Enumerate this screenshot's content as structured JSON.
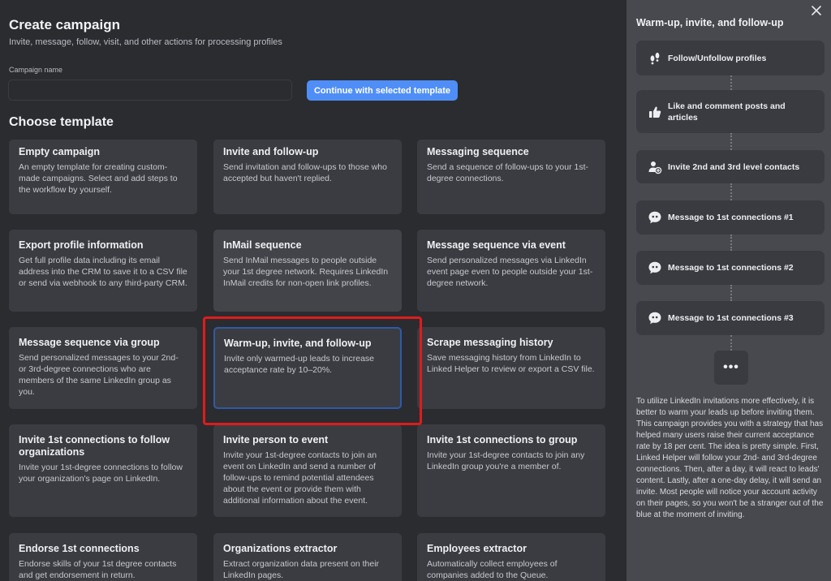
{
  "header": {
    "title": "Create campaign",
    "subtitle": "Invite, message, follow, visit, and other actions for processing profiles"
  },
  "form": {
    "campaign_name_label": "Campaign name",
    "campaign_name_value": "",
    "continue_label": "Continue with selected template"
  },
  "templates": {
    "heading": "Choose template",
    "cards": [
      {
        "title": "Empty campaign",
        "desc": "An empty template for creating custom-made campaigns. Select and add steps to the workflow by yourself."
      },
      {
        "title": "Invite and follow-up",
        "desc": "Send invitation and follow-ups to those who accepted but haven't replied."
      },
      {
        "title": "Messaging sequence",
        "desc": "Send a sequence of follow-ups to your 1st-degree connections."
      },
      {
        "title": "Export profile information",
        "desc": "Get full profile data including its email address into the CRM to save it to a CSV file or send via webhook to any third-party CRM."
      },
      {
        "title": "InMail sequence",
        "desc": "Send InMail messages to people outside your 1st degree network. Requires LinkedIn InMail credits for non-open link profiles."
      },
      {
        "title": "Message sequence via event",
        "desc": "Send personalized messages via LinkedIn event page even to people outside your 1st-degree network."
      },
      {
        "title": "Message sequence via group",
        "desc": "Send personalized messages to your 2nd- or 3rd-degree connections who are members of the same LinkedIn group as you."
      },
      {
        "title": "Warm-up, invite, and follow-up",
        "desc": "Invite only warmed-up leads to increase acceptance rate by 10–20%."
      },
      {
        "title": "Scrape messaging history",
        "desc": "Save messaging history from LinkedIn to Linked Helper to review or export a CSV file."
      },
      {
        "title": "Invite 1st connections to follow organizations",
        "desc": "Invite your 1st-degree connections to follow your organization's page on LinkedIn."
      },
      {
        "title": "Invite person to event",
        "desc": "Invite your 1st-degree contacts to join an event on LinkedIn and send a number of follow-ups to remind potential attendees about the event or provide them with additional information about the event."
      },
      {
        "title": "Invite 1st connections to group",
        "desc": "Invite your 1st-degree contacts to join any LinkedIn group you're a member of."
      },
      {
        "title": "Endorse 1st connections",
        "desc": "Endorse skills of your 1st degree contacts and get endorsement in return."
      },
      {
        "title": "Organizations extractor",
        "desc": "Extract organization data present on their LinkedIn pages."
      },
      {
        "title": "Employees extractor",
        "desc": "Automatically collect employees of companies added to the Queue."
      }
    ]
  },
  "panel": {
    "close_icon": "close-icon",
    "title": "Warm-up, invite, and follow-up",
    "steps": [
      {
        "label": "Follow/Unfollow profiles",
        "icon": "footprints-icon"
      },
      {
        "label": "Like and comment posts and articles",
        "icon": "thumbs-up-icon"
      },
      {
        "label": "Invite 2nd and 3rd level contacts",
        "icon": "add-person-icon"
      },
      {
        "label": "Message to 1st connections #1",
        "icon": "chat-bubble-icon"
      },
      {
        "label": "Message to 1st connections #2",
        "icon": "chat-bubble-icon"
      },
      {
        "label": "Message to 1st connections #3",
        "icon": "chat-bubble-icon"
      }
    ],
    "more_label": "•••",
    "description": "To utilize LinkedIn invitations more effectively, it is better to warm your leads up before inviting them. This campaign provides you with a strategy that has helped many users raise their current acceptance rate by 18 per cent. The idea is pretty simple. First, Linked Helper will follow your 2nd- and 3rd-degree connections. Then, after a day, it will react to leads' content. Lastly, after a one-day delay, it will send an invite. Most people will notice your account activity on their pages, so you won't be a stranger out of the blue at the moment of inviting."
  },
  "colors": {
    "accent": "#4f8ef7",
    "highlight": "#e01b1b",
    "selected_border": "#2f5aa8"
  }
}
